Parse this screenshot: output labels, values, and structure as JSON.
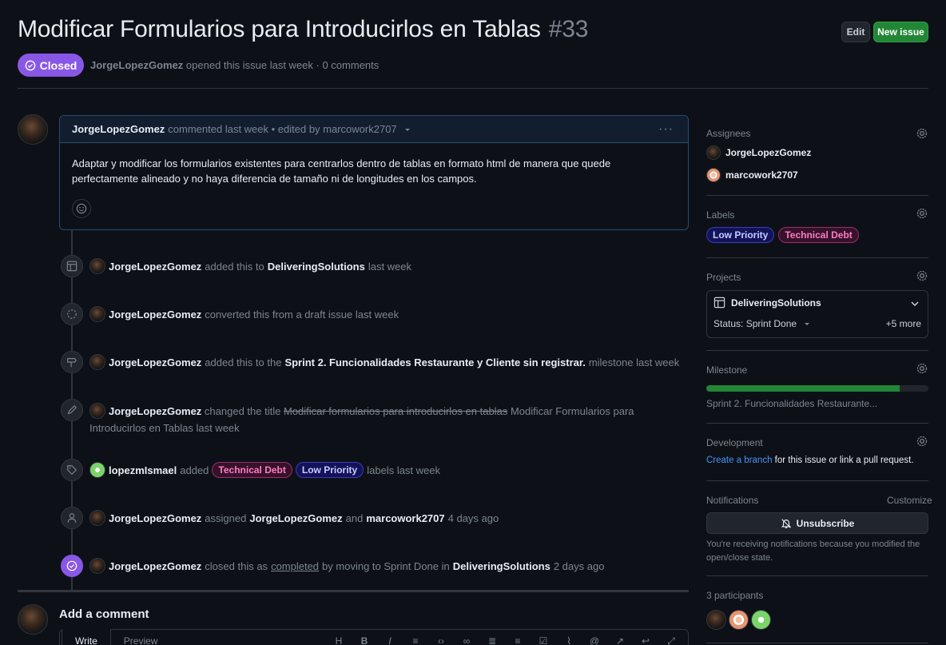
{
  "issue": {
    "title": "Modificar Formularios para Introducirlos en Tablas",
    "number": "#33",
    "state": "Closed",
    "author": "JorgeLopezGomez",
    "opened_text": "opened this issue last week · 0 comments"
  },
  "header": {
    "edit_label": "Edit",
    "new_issue_label": "New issue"
  },
  "comment": {
    "author": "JorgeLopezGomez",
    "meta": "commented last week • edited by marcowork2707",
    "body": "Adaptar y modificar los formularios existentes para centrarlos dentro de tablas en formato html de manera que quede perfectamente alineado y no haya diferencia de tamaño ni de longitudes en los campos."
  },
  "timeline": [
    {
      "icon": "table-icon",
      "actor": "JorgeLopezGomez",
      "text": "added this to",
      "target": "DeliveringSolutions",
      "suffix": "last week"
    },
    {
      "icon": "draft-circle-icon",
      "actor": "JorgeLopezGomez",
      "text": "converted this from a draft issue last week"
    },
    {
      "icon": "milestone-icon",
      "actor": "JorgeLopezGomez",
      "text": "added this to the",
      "target": "Sprint 2. Funcionalidades Restaurante y Cliente sin registrar.",
      "suffix": "milestone last week"
    },
    {
      "icon": "pencil-icon",
      "actor": "JorgeLopezGomez",
      "text": "changed the title",
      "old_title": "Modificar formularios para introducirlos en tablas",
      "new_title": "Modificar Formularios para",
      "new_title_2": "Introducirlos en Tablas",
      "suffix": "last week"
    },
    {
      "icon": "tag-icon",
      "actor": "lopezmIsmael",
      "text": "added",
      "labels": [
        "Technical Debt",
        "Low Priority"
      ],
      "suffix": "labels last week"
    },
    {
      "icon": "person-icon",
      "actor": "JorgeLopezGomez",
      "text": "assigned",
      "target": "JorgeLopezGomez",
      "and": "and",
      "target2": "marcowork2707",
      "suffix": "4 days ago"
    },
    {
      "icon": "check-circle-icon",
      "actor": "JorgeLopezGomez",
      "text": "closed this as",
      "completed": "completed",
      "mid": "by moving to Sprint Done in",
      "target": "DeliveringSolutions",
      "suffix": "2 days ago"
    }
  ],
  "add_comment": {
    "title": "Add a comment",
    "tab_write": "Write",
    "tab_preview": "Preview"
  },
  "sidebar": {
    "assignees_title": "Assignees",
    "assignees": [
      "JorgeLopezGomez",
      "marcowork2707"
    ],
    "labels_title": "Labels",
    "labels": [
      "Low Priority",
      "Technical Debt"
    ],
    "projects_title": "Projects",
    "project_name": "DeliveringSolutions",
    "project_status": "Status: Sprint Done",
    "project_more": "+5 more",
    "milestone_title": "Milestone",
    "milestone_name": "Sprint 2. Funcionalidades Restaurante...",
    "milestone_progress": 0.87,
    "development_title": "Development",
    "dev_link": "Create a branch",
    "dev_text": "for this issue or link a pull request.",
    "notifications_title": "Notifications",
    "customize": "Customize",
    "unsubscribe": "Unsubscribe",
    "notif_text_1": "You're receiving notifications because you modified the",
    "notif_text_2": "open/close state.",
    "participants_title": "3 participants"
  },
  "colors": {
    "closed": "#8957e5",
    "accent": "#238636",
    "link": "#4493f8"
  }
}
